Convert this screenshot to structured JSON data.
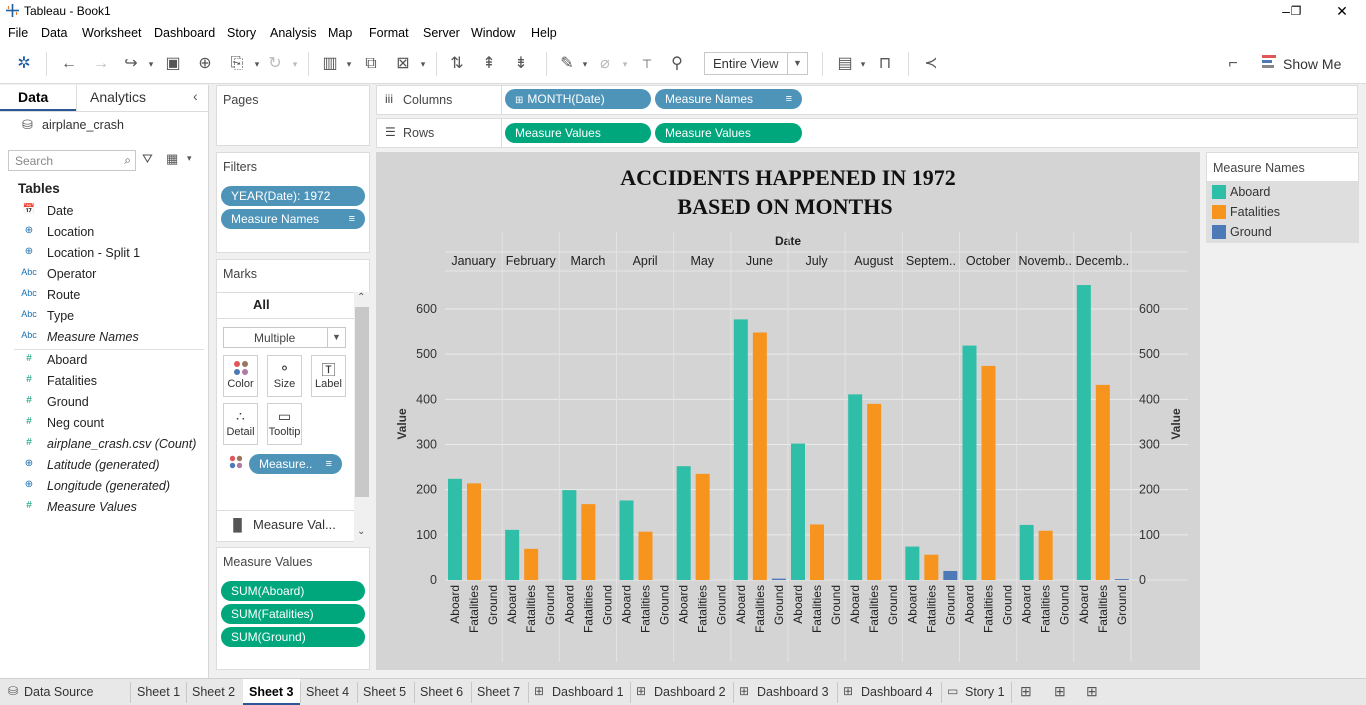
{
  "window": {
    "title": "Tableau - Book1"
  },
  "menu": [
    "File",
    "Data",
    "Worksheet",
    "Dashboard",
    "Story",
    "Analysis",
    "Map",
    "Format",
    "Server",
    "Window",
    "Help"
  ],
  "toolbar": {
    "view_select": "Entire View",
    "show_me": "Show Me"
  },
  "data_pane": {
    "tab_data": "Data",
    "tab_analytics": "Analytics",
    "datasource": "airplane_crash",
    "search_placeholder": "Search",
    "tables_heading": "Tables",
    "fields": [
      {
        "label": "Date",
        "type": "date",
        "italic": false
      },
      {
        "label": "Location",
        "type": "geo",
        "italic": false
      },
      {
        "label": "Location - Split 1",
        "type": "geo",
        "italic": false
      },
      {
        "label": "Operator",
        "type": "abc",
        "italic": false
      },
      {
        "label": "Route",
        "type": "abc",
        "italic": false
      },
      {
        "label": "Type",
        "type": "abc",
        "italic": false
      },
      {
        "label": "Measure Names",
        "type": "abc",
        "italic": true
      },
      {
        "label": "Aboard",
        "type": "num",
        "italic": false
      },
      {
        "label": "Fatalities",
        "type": "num",
        "italic": false
      },
      {
        "label": "Ground",
        "type": "num",
        "italic": false
      },
      {
        "label": "Neg count",
        "type": "num",
        "italic": false
      },
      {
        "label": "airplane_crash.csv (Count)",
        "type": "num",
        "italic": true
      },
      {
        "label": "Latitude (generated)",
        "type": "geo",
        "italic": true
      },
      {
        "label": "Longitude (generated)",
        "type": "geo",
        "italic": true
      },
      {
        "label": "Measure Values",
        "type": "num",
        "italic": true
      }
    ]
  },
  "pages": {
    "title": "Pages"
  },
  "filters": {
    "title": "Filters",
    "items": [
      "YEAR(Date): 1972",
      "Measure Names"
    ]
  },
  "marks": {
    "title": "Marks",
    "all_label": "All",
    "mark_type": "Multiple",
    "buttons": [
      "Color",
      "Size",
      "Label",
      "Detail",
      "Tooltip"
    ],
    "color_pill": "Measure..",
    "measure_values_row": "Measure Val..."
  },
  "measure_values_card": {
    "title": "Measure Values",
    "items": [
      "SUM(Aboard)",
      "SUM(Fatalities)",
      "SUM(Ground)"
    ]
  },
  "shelves": {
    "columns_label": "Columns",
    "rows_label": "Rows",
    "columns": [
      "MONTH(Date)",
      "Measure Names"
    ],
    "rows": [
      "Measure Values",
      "Measure Values"
    ]
  },
  "legend": {
    "title": "Measure Names",
    "items": [
      {
        "label": "Aboard",
        "color": "#2fbfa8"
      },
      {
        "label": "Fatalities",
        "color": "#f7941d"
      },
      {
        "label": "Ground",
        "color": "#4e79b7"
      }
    ]
  },
  "chart_data": {
    "type": "bar",
    "title_line1": "ACCIDENTS HAPPENED IN 1972",
    "title_line2": "BASED ON MONTHS",
    "column_header": "Date",
    "ylabel": "Value",
    "ylabel_right": "Value",
    "ylim": [
      0,
      660
    ],
    "yticks": [
      0,
      100,
      200,
      300,
      400,
      500,
      600
    ],
    "categories": [
      "January",
      "February",
      "March",
      "April",
      "May",
      "June",
      "July",
      "August",
      "Septem..",
      "October",
      "Novemb..",
      "Decemb.."
    ],
    "sub_categories": [
      "Aboard",
      "Fatalities",
      "Ground"
    ],
    "series": [
      {
        "name": "Aboard",
        "color": "#2fbfa8",
        "values": [
          224,
          111,
          199,
          176,
          252,
          577,
          302,
          411,
          74,
          519,
          122,
          653
        ]
      },
      {
        "name": "Fatalities",
        "color": "#f7941d",
        "values": [
          214,
          69,
          168,
          107,
          235,
          548,
          123,
          390,
          56,
          474,
          109,
          432
        ]
      },
      {
        "name": "Ground",
        "color": "#4e79b7",
        "values": [
          0,
          0,
          0,
          0,
          0,
          3,
          0,
          0,
          20,
          0,
          0,
          2
        ]
      }
    ],
    "grid": true
  },
  "bottom_tabs": [
    "Data Source",
    "Sheet 1",
    "Sheet 2",
    "Sheet 3",
    "Sheet 4",
    "Sheet 5",
    "Sheet 6",
    "Sheet 7",
    "Dashboard 1",
    "Dashboard 2",
    "Dashboard 3",
    "Dashboard 4",
    "Story 1"
  ],
  "active_tab": "Sheet 3"
}
